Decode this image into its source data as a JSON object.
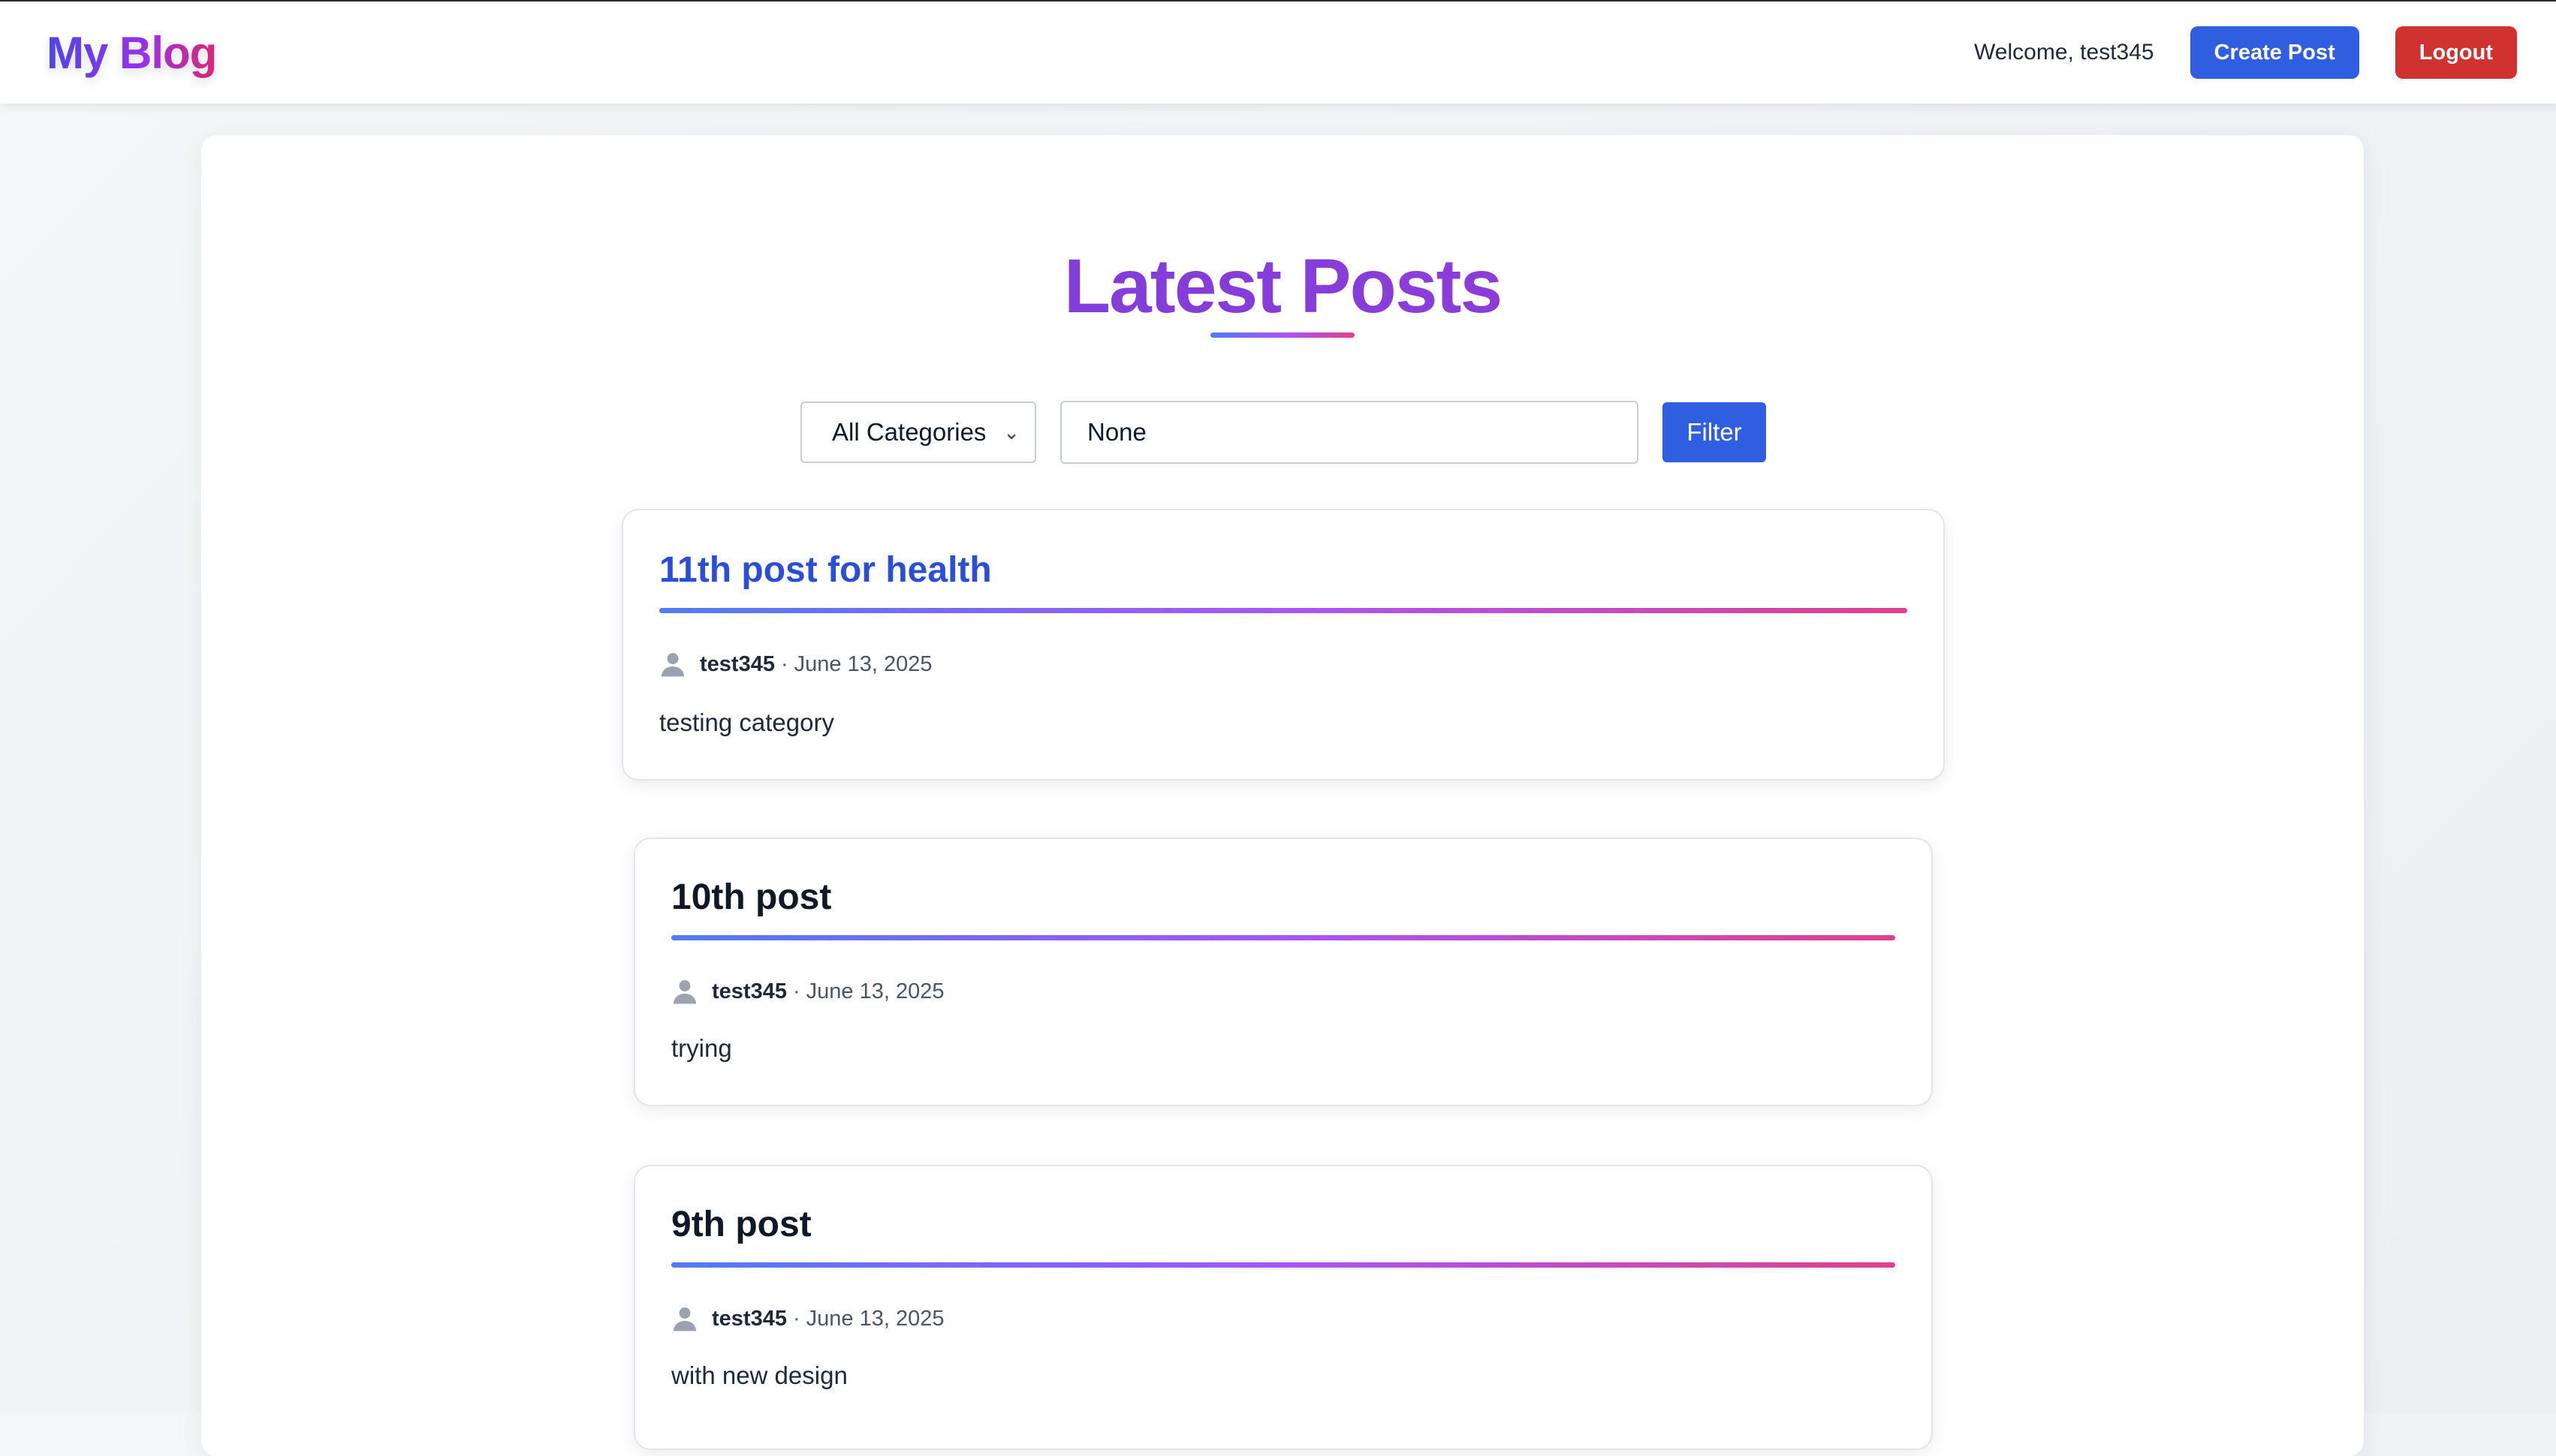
{
  "header": {
    "brand": "My Blog",
    "welcome": "Welcome, test345",
    "create_label": "Create Post",
    "logout_label": "Logout"
  },
  "main": {
    "title": "Latest Posts",
    "filter": {
      "category_selected": "All Categories",
      "search_value": "None",
      "filter_label": "Filter"
    },
    "posts": [
      {
        "title": "11th post for health",
        "author": "test345",
        "separator": "·",
        "date": "June 13, 2025",
        "excerpt": "testing category"
      },
      {
        "title": "10th post",
        "author": "test345",
        "separator": "·",
        "date": "June 13, 2025",
        "excerpt": "trying"
      },
      {
        "title": "9th post",
        "author": "test345",
        "separator": "·",
        "date": "June 13, 2025",
        "excerpt": "with new design"
      }
    ]
  },
  "colors": {
    "primary": "#2f5fe0",
    "danger": "#d0322f",
    "heading_gradient_start": "#6d3fdc",
    "heading_gradient_end": "#a03bd6",
    "active_title": "#2a4fd6"
  },
  "icons": {
    "author": "user-icon",
    "select": "chevron-down-icon"
  }
}
